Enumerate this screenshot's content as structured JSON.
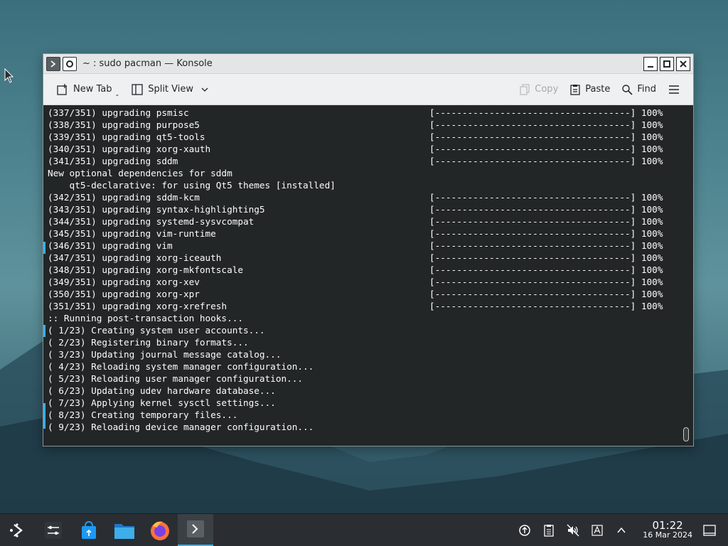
{
  "window": {
    "title": "~ : sudo pacman — Konsole",
    "minimize_icon": "minimize-icon",
    "maximize_icon": "maximize-icon",
    "close_icon": "close-icon"
  },
  "toolbar": {
    "new_tab": "New Tab",
    "split_view": "Split View",
    "copy": "Copy",
    "paste": "Paste",
    "find": "Find"
  },
  "terminal": {
    "lines": [
      {
        "pkg": "(337/351) upgrading psmisc",
        "bar": "[------------------------------------] 100%"
      },
      {
        "pkg": "(338/351) upgrading purpose5",
        "bar": "[------------------------------------] 100%"
      },
      {
        "pkg": "(339/351) upgrading qt5-tools",
        "bar": "[------------------------------------] 100%"
      },
      {
        "pkg": "(340/351) upgrading xorg-xauth",
        "bar": "[------------------------------------] 100%"
      },
      {
        "pkg": "(341/351) upgrading sddm",
        "bar": "[------------------------------------] 100%"
      },
      {
        "pkg": "New optional dependencies for sddm",
        "bar": ""
      },
      {
        "pkg": "    qt5-declarative: for using Qt5 themes [installed]",
        "bar": ""
      },
      {
        "pkg": "(342/351) upgrading sddm-kcm",
        "bar": "[------------------------------------] 100%"
      },
      {
        "pkg": "(343/351) upgrading syntax-highlighting5",
        "bar": "[------------------------------------] 100%"
      },
      {
        "pkg": "(344/351) upgrading systemd-sysvcompat",
        "bar": "[------------------------------------] 100%"
      },
      {
        "pkg": "(345/351) upgrading vim-runtime",
        "bar": "[------------------------------------] 100%"
      },
      {
        "pkg": "(346/351) upgrading vim",
        "bar": "[------------------------------------] 100%"
      },
      {
        "pkg": "(347/351) upgrading xorg-iceauth",
        "bar": "[------------------------------------] 100%"
      },
      {
        "pkg": "(348/351) upgrading xorg-mkfontscale",
        "bar": "[------------------------------------] 100%"
      },
      {
        "pkg": "(349/351) upgrading xorg-xev",
        "bar": "[------------------------------------] 100%"
      },
      {
        "pkg": "(350/351) upgrading xorg-xpr",
        "bar": "[------------------------------------] 100%"
      },
      {
        "pkg": "(351/351) upgrading xorg-xrefresh",
        "bar": "[------------------------------------] 100%"
      },
      {
        "pkg": ":: Running post-transaction hooks...",
        "bar": ""
      },
      {
        "pkg": "( 1/23) Creating system user accounts...",
        "bar": ""
      },
      {
        "pkg": "( 2/23) Registering binary formats...",
        "bar": ""
      },
      {
        "pkg": "( 3/23) Updating journal message catalog...",
        "bar": ""
      },
      {
        "pkg": "( 4/23) Reloading system manager configuration...",
        "bar": ""
      },
      {
        "pkg": "( 5/23) Reloading user manager configuration...",
        "bar": ""
      },
      {
        "pkg": "( 6/23) Updating udev hardware database...",
        "bar": ""
      },
      {
        "pkg": "( 7/23) Applying kernel sysctl settings...",
        "bar": ""
      },
      {
        "pkg": "( 8/23) Creating temporary files...",
        "bar": ""
      },
      {
        "pkg": "( 9/23) Reloading device manager configuration...",
        "bar": ""
      }
    ]
  },
  "taskbar": {
    "apps": [
      {
        "name": "app-launcher",
        "icon": "kde-launcher-icon"
      },
      {
        "name": "system-settings",
        "icon": "settings-sliders-icon"
      },
      {
        "name": "discover",
        "icon": "store-bag-icon"
      },
      {
        "name": "dolphin",
        "icon": "folder-icon"
      },
      {
        "name": "firefox",
        "icon": "firefox-icon"
      },
      {
        "name": "konsole",
        "icon": "terminal-icon"
      }
    ],
    "clock_time": "01:22",
    "clock_date": "16 Mar 2024"
  },
  "colors": {
    "accent": "#3daee9",
    "terminal_bg": "#232627",
    "terminal_fg": "#fcfcfc",
    "panel": "#2a2e32"
  }
}
